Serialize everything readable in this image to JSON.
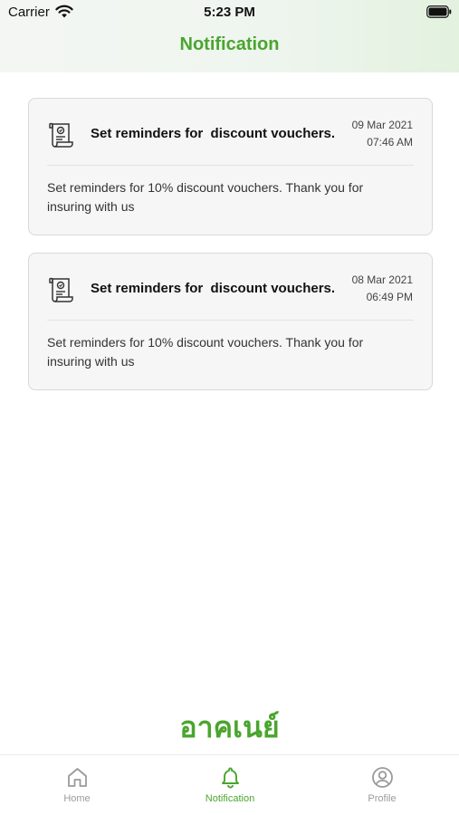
{
  "status_bar": {
    "carrier": "Carrier",
    "time": "5:23 PM"
  },
  "header": {
    "title": "Notification"
  },
  "notifications": [
    {
      "title": "Set reminders for  discount vouchers.",
      "date": "09 Mar 2021",
      "time": "07:46 AM",
      "body": "Set reminders for 10% discount vouchers. Thank you for insuring with us"
    },
    {
      "title": "Set reminders for  discount vouchers.",
      "date": "08 Mar 2021",
      "time": "06:49 PM",
      "body": "Set reminders for 10% discount vouchers. Thank you for insuring with us"
    }
  ],
  "brand": {
    "logo_text": "อาคเนย์"
  },
  "tabbar": {
    "items": [
      {
        "label": "Home",
        "icon": "home-icon",
        "active": false
      },
      {
        "label": "Notification",
        "icon": "bell-icon",
        "active": true
      },
      {
        "label": "Profile",
        "icon": "profile-icon",
        "active": false
      }
    ]
  },
  "colors": {
    "accent": "#4aa52e",
    "inactive": "#9a9a9a",
    "card_bg": "#f6f6f6"
  }
}
